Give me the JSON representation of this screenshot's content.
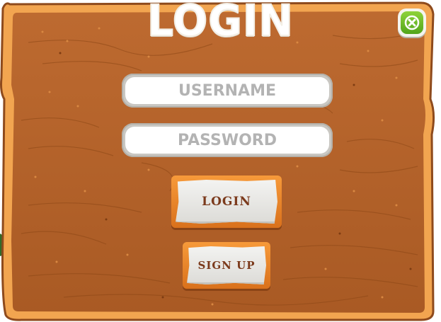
{
  "dialog": {
    "title": "LOGIN"
  },
  "form": {
    "username_placeholder": "USERNAME",
    "password_placeholder": "PASSWORD"
  },
  "buttons": {
    "login_label": "LOGIN",
    "signup_label": "SIGN UP",
    "close_icon": "close-x"
  },
  "colors": {
    "wood": "#b5622a",
    "wood_border": "#f0a04c",
    "close_green": "#6cbf28",
    "button_text": "#7b3a1c",
    "placeholder_text": "#b3b3b3"
  }
}
